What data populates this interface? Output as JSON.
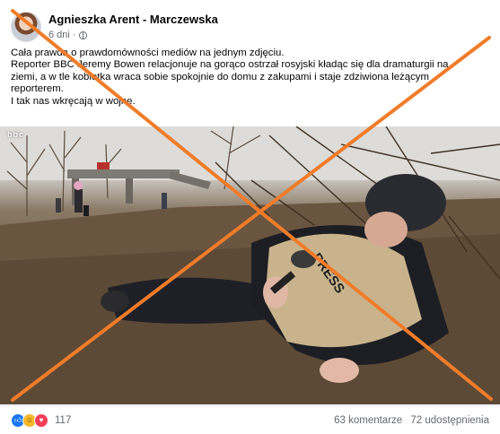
{
  "post": {
    "author": "Agnieszka Arent - Marczewska",
    "timestamp": "6 dni",
    "separator": "·",
    "privacy_icon": "globe-icon",
    "text_lines": [
      "Cała prawda o prawdomówności mediów na jednym zdjęciu.",
      "Reporter BBC Jeremy Bowen relacjonuje na gorąco ostrzał rosyjski kładąc się dla dramaturgii na",
      "ziemi, a w tle kobietka wraca sobie spokojnie do domu z zakupami i staje zdziwiona leżącym",
      "reporterem.",
      "I tak nas wkręcają w wojnę."
    ]
  },
  "photo": {
    "watermark": "bbc",
    "vest_label": "PRESS"
  },
  "footer": {
    "reaction_icons": [
      "like-icon",
      "haha-icon",
      "love-icon"
    ],
    "reaction_count": "117",
    "comments": "63 komentarze",
    "shares": "72 udostępnienia"
  },
  "overlay": {
    "cross_color": "#f07c2a"
  }
}
